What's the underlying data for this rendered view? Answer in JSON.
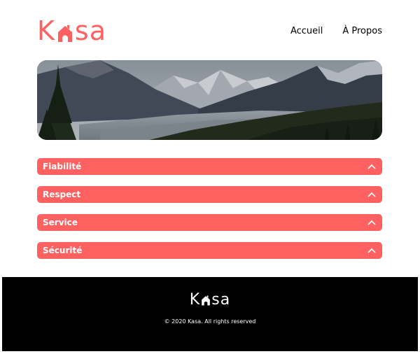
{
  "brand": {
    "name_prefix": "K",
    "name_suffix": "sa",
    "accent_color": "#ff6060",
    "logo_icon": "house-icon"
  },
  "nav": {
    "items": [
      {
        "label": "Accueil"
      },
      {
        "label": "À Propos"
      }
    ]
  },
  "banner": {
    "image": "mountain-landscape-photo"
  },
  "collapses": [
    {
      "title": "Fiabilité",
      "icon": "chevron-up-icon"
    },
    {
      "title": "Respect",
      "icon": "chevron-up-icon"
    },
    {
      "title": "Service",
      "icon": "chevron-up-icon"
    },
    {
      "title": "Sécurité",
      "icon": "chevron-up-icon"
    }
  ],
  "footer": {
    "logo_prefix": "K",
    "logo_suffix": "sa",
    "copyright": "© 2020 Kasa. All rights reserved"
  }
}
